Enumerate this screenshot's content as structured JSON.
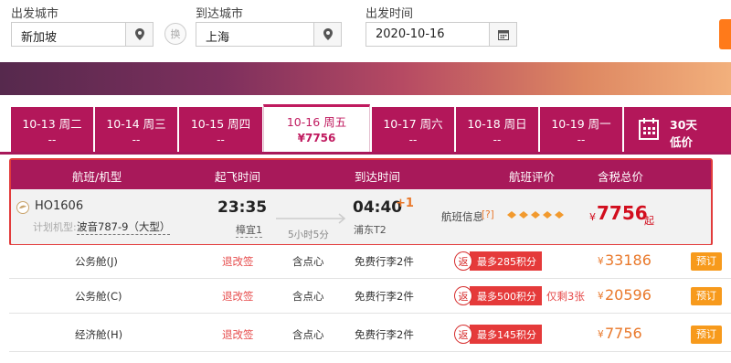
{
  "search": {
    "from_label": "出发城市",
    "from_value": "新加坡",
    "to_label": "到达城市",
    "to_value": "上海",
    "swap_label": "换",
    "date_label": "出发时间",
    "date_value": "2020-10-16"
  },
  "dates": [
    {
      "date": "10-13 周二",
      "price": "--"
    },
    {
      "date": "10-14 周三",
      "price": "--"
    },
    {
      "date": "10-15 周四",
      "price": "--"
    },
    {
      "date": "10-16 周五",
      "price": "¥7756"
    },
    {
      "date": "10-17 周六",
      "price": "--"
    },
    {
      "date": "10-18 周日",
      "price": "--"
    },
    {
      "date": "10-19 周一",
      "price": "--"
    }
  ],
  "calendar": {
    "line1": "30天",
    "line2": "低价"
  },
  "table_header": {
    "flight": "航班/机型",
    "depart": "起飞时间",
    "arrive": "到达时间",
    "rating": "航班评价",
    "price": "含税总价"
  },
  "flight": {
    "number": "HO1606",
    "plane_label": "计划机型:",
    "plane": "波音787-9（大型）",
    "depart_time": "23:35",
    "depart_airport": "樟宜1",
    "duration": "5小时5分",
    "arrive_time": "04:40",
    "arrive_plus": "+1",
    "arrive_airport": "浦东T2",
    "info_label": "航班信息",
    "info_q": "[?]",
    "currency": "¥",
    "price": "7756",
    "price_suffix": "起"
  },
  "cabins": [
    {
      "name": "公务舱(J)",
      "refund": "退改签",
      "meal": "含点心",
      "baggage": "免费行李2件",
      "fan": "返",
      "points": "最多285积分",
      "left": "",
      "currency": "¥",
      "price": "33186",
      "book": "预订"
    },
    {
      "name": "公务舱(C)",
      "refund": "退改签",
      "meal": "含点心",
      "baggage": "免费行李2件",
      "fan": "返",
      "points": "最多500积分",
      "left": "仅剩3张",
      "currency": "¥",
      "price": "20596",
      "book": "预订"
    },
    {
      "name": "经济舱(H)",
      "refund": "退改签",
      "meal": "含点心",
      "baggage": "免费行李2件",
      "fan": "返",
      "points": "最多145积分",
      "left": "",
      "currency": "¥",
      "price": "7756",
      "book": "预订"
    }
  ],
  "colors": {
    "brand": "#a8195a",
    "active_text": "#c01a5f",
    "price_red": "#d20e1e",
    "price_orange": "#e9782a",
    "highlight_border": "#e23b3b",
    "book_button": "#f79a1c"
  }
}
